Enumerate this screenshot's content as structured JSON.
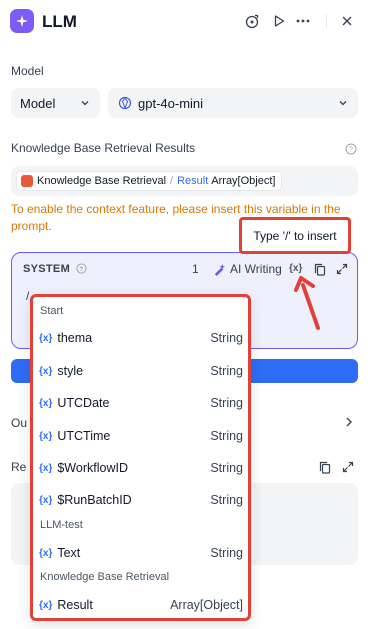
{
  "header": {
    "title": "LLM",
    "icons": [
      "sparkle-logo-icon",
      "run-history-icon",
      "play-icon",
      "more-icon",
      "close-icon"
    ]
  },
  "model": {
    "section_label": "Model",
    "provider_select": "Model",
    "model_select": "gpt-4o-mini"
  },
  "knowledge": {
    "section_label": "Knowledge Base Retrieval Results",
    "chip_source": "Knowledge Base Retrieval",
    "chip_separator": "/",
    "chip_var": "Result",
    "chip_type": "Array[Object]",
    "warning": "To enable the context feature, please insert this variable in the prompt."
  },
  "tooltip": {
    "text": "Type '/' to insert"
  },
  "editor": {
    "role": "SYSTEM",
    "count": "1",
    "ai_writing": "AI Writing",
    "var_button": "{x}",
    "content": "/"
  },
  "output": {
    "label": "Ou"
  },
  "reply": {
    "label": "Re"
  },
  "dropdown": {
    "groups": [
      {
        "name": "Start",
        "vars": [
          {
            "name": "thema",
            "type": "String"
          },
          {
            "name": "style",
            "type": "String"
          },
          {
            "name": "UTCDate",
            "type": "String"
          },
          {
            "name": "UTCTime",
            "type": "String"
          },
          {
            "name": "$WorkflowID",
            "type": "String"
          },
          {
            "name": "$RunBatchID",
            "type": "String"
          }
        ]
      },
      {
        "name": "LLM-test",
        "vars": [
          {
            "name": "Text",
            "type": "String"
          }
        ]
      },
      {
        "name": "Knowledge Base Retrieval",
        "vars": [
          {
            "name": "Result",
            "type": "Array[Object]"
          }
        ]
      }
    ],
    "var_icon": "{x}"
  },
  "colors": {
    "accent": "#6b5cf0",
    "primary_blue": "#2e6cf6",
    "warning": "#d97706",
    "annotation_red": "#e2413a"
  }
}
